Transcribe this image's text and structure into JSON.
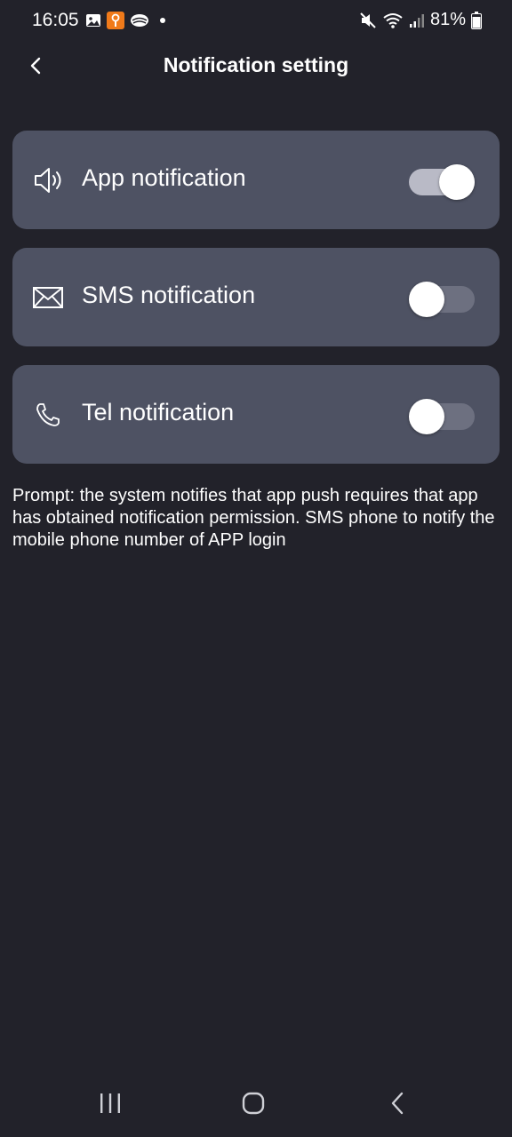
{
  "status_bar": {
    "time": "16:05",
    "battery": "81%",
    "icons_left": [
      "gallery-icon",
      "app-badge-icon",
      "cloud-icon",
      "dot-icon"
    ],
    "icons_right": [
      "mute-icon",
      "wifi-icon",
      "signal-icon",
      "battery-icon"
    ]
  },
  "header": {
    "title": "Notification setting",
    "back_icon": "chevron-left-icon"
  },
  "settings": [
    {
      "label": "App notification",
      "icon": "speaker-icon",
      "enabled": true
    },
    {
      "label": "SMS notification",
      "icon": "envelope-icon",
      "enabled": false
    },
    {
      "label": "Tel notification",
      "icon": "phone-icon",
      "enabled": false
    }
  ],
  "prompt": "Prompt: the system notifies that app push requires that app has obtained notification permission. SMS phone to notify the mobile phone number of APP login",
  "colors": {
    "background": "#22222a",
    "card": "#4e5263",
    "toggle_on_track": "#b9bac6",
    "toggle_off_track": "#6d7080"
  },
  "nav_bar": {
    "buttons": [
      "recent-apps-icon",
      "home-icon",
      "back-icon"
    ]
  }
}
